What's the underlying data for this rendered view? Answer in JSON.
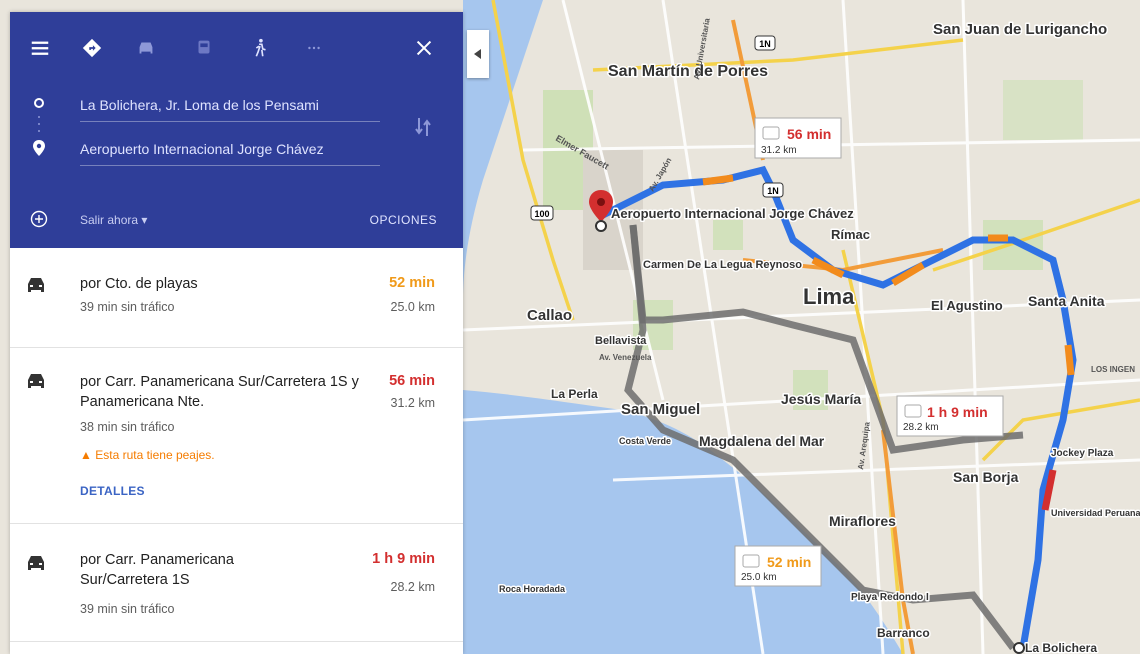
{
  "panel": {
    "origin": "La Bolichera, Jr. Loma de los Pensami",
    "destination": "Aeropuerto Internacional Jorge Chávez",
    "depart_label": "Salir ahora",
    "options_label": "OPCIONES",
    "modes": [
      "driving-icon",
      "transit-icon",
      "walking-icon"
    ]
  },
  "routes": [
    {
      "title": "por Cto. de playas",
      "time": "52 min",
      "time_color": "#f09a1a",
      "traffic": "39 min sin tráfico",
      "distance": "25.0 km"
    },
    {
      "title": "por Carr. Panamericana Sur/Carretera 1S y Panamericana Nte.",
      "time": "56 min",
      "time_color": "#d32f2f",
      "traffic": "38 min sin tráfico",
      "distance": "31.2 km",
      "warning": "Esta ruta tiene peajes.",
      "details": "DETALLES"
    },
    {
      "title": "por Carr. Panamericana Sur/Carretera 1S",
      "time": "1 h 9 min",
      "time_color": "#d32f2f",
      "traffic": "39 min sin tráfico",
      "distance": "28.2 km"
    }
  ],
  "map": {
    "labels": {
      "san_martin": "San Martín de Porres",
      "sjl": "San Juan de Lurigancho",
      "rimac": "Rímac",
      "lima": "Lima",
      "callao": "Callao",
      "el_agustino": "El Agustino",
      "santa_anita": "Santa Anita",
      "carmen": "Carmen De La Legua Reynoso",
      "bellavista": "Bellavista",
      "la_perla": "La Perla",
      "san_miguel": "San Miguel",
      "jesus_maria": "Jesús María",
      "magdalena": "Magdalena del Mar",
      "san_borja": "San Borja",
      "jockey": "Jockey Plaza",
      "upc": "Universidad Peruana de Ciencias Aplicadas",
      "miraflores": "Miraflores",
      "barranco": "Barranco",
      "playa": "Playa Redondo I",
      "roca": "Roca Horadada",
      "costa_verde": "Costa Verde",
      "airport": "Aeropuerto Internacional Jorge Chávez",
      "la_bolichera": "La Bolichera",
      "highway_1n": "1N",
      "highway_100": "100",
      "av_venezuela": "Av. Venezuela",
      "av_universitaria": "Av. Universitaria",
      "elmer_faucett": "Elmer Faucett",
      "av_japon": "Av. Japón",
      "los_inge": "LOS INGEN",
      "av_arequipa": "Av. Arequipa"
    },
    "callouts": [
      {
        "time": "56 min",
        "distance": "31.2 km"
      },
      {
        "time": "1 h 9 min",
        "distance": "28.2 km"
      },
      {
        "time": "52 min",
        "distance": "25.0 km"
      }
    ]
  }
}
